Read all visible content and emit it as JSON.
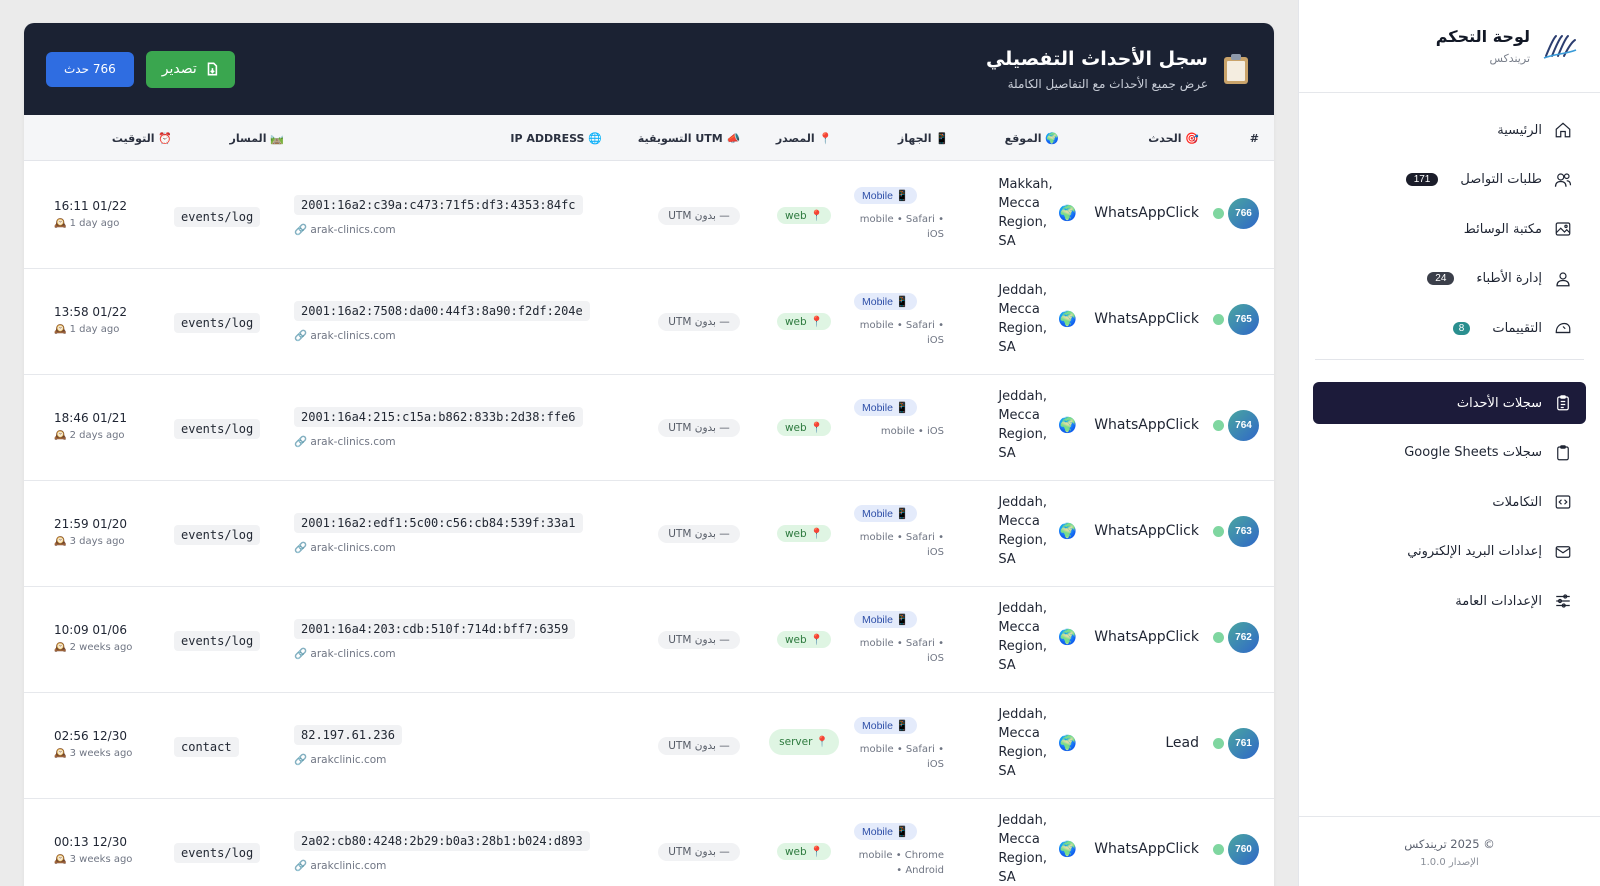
{
  "sidebar": {
    "brand_title": "لوحة التحكم",
    "brand_sub": "تريندكس",
    "items": [
      {
        "label": "الرئيسية",
        "icon": "home-icon",
        "badge": ""
      },
      {
        "label": "طلبات التواصل",
        "icon": "users-icon",
        "badge": "171",
        "badge_color": "#1b1d2a"
      },
      {
        "label": "مكتبة الوسائط",
        "icon": "image-icon",
        "badge": ""
      },
      {
        "label": "إدارة الأطباء",
        "icon": "user-icon",
        "badge": "24",
        "badge_color": "#3b3f4a"
      },
      {
        "label": "التقييمات",
        "icon": "rating-icon",
        "badge": "8",
        "badge_color": "#2a8f8f"
      }
    ],
    "items2": [
      {
        "label": "سجلات الأحداث",
        "icon": "clipboard-icon",
        "active": true
      },
      {
        "label": "سجلات Google Sheets",
        "icon": "sheet-icon"
      },
      {
        "label": "التكاملات",
        "icon": "code-icon"
      },
      {
        "label": "إعدادات البريد الإلكتروني",
        "icon": "mail-icon"
      },
      {
        "label": "الإعدادات العامة",
        "icon": "sliders-icon"
      }
    ],
    "footer": "© 2025 تريندكس",
    "version": "الإصدار 1.0.0"
  },
  "header": {
    "title": "سجل الأحداث التفصيلي",
    "subtitle": "عرض جميع الأحداث مع التفاصيل الكاملة",
    "export_label": "تصدير",
    "count_label": "766 حدث"
  },
  "columns": {
    "num": "#",
    "event": "🎯 الحدث",
    "location": "🌍 الموقع",
    "device": "📱 الجهاز",
    "source": "📍 المصدر",
    "utm": "�However UTM التسويقية",
    "ip": "🌐 IP ADDRESS",
    "path": "🛤️ المسار",
    "time": "⏰ التوقيت"
  },
  "rows": [
    {
      "num": "766",
      "event": "WhatsAppClick",
      "location": "Makkah, Mecca Region, SA",
      "device": "Mobile 📱",
      "device_sub": "mobile • Safari • iOS",
      "source": "📍 web",
      "utm": "— بدون UTM",
      "ip": "2001:16a2:c39a:c473:71f5:df3:4353:84fc",
      "host": "🔗 arak-clinics.com",
      "path": "events/log",
      "time": "16:11 01/22",
      "ago": "🕰️ 1 day ago"
    },
    {
      "num": "765",
      "event": "WhatsAppClick",
      "location": "Jeddah, Mecca Region, SA",
      "device": "Mobile 📱",
      "device_sub": "mobile • Safari • iOS",
      "source": "📍 web",
      "utm": "— بدون UTM",
      "ip": "2001:16a2:7508:da00:44f3:8a90:f2df:204e",
      "host": "🔗 arak-clinics.com",
      "path": "events/log",
      "time": "13:58 01/22",
      "ago": "🕰️ 1 day ago"
    },
    {
      "num": "764",
      "event": "WhatsAppClick",
      "location": "Jeddah, Mecca Region, SA",
      "device": "Mobile 📱",
      "device_sub": "mobile • iOS",
      "source": "📍 web",
      "utm": "— بدون UTM",
      "ip": "2001:16a4:215:c15a:b862:833b:2d38:ffe6",
      "host": "🔗 arak-clinics.com",
      "path": "events/log",
      "time": "18:46 01/21",
      "ago": "🕰️ 2 days ago"
    },
    {
      "num": "763",
      "event": "WhatsAppClick",
      "location": "Jeddah, Mecca Region, SA",
      "device": "Mobile 📱",
      "device_sub": "mobile • Safari • iOS",
      "source": "📍 web",
      "utm": "— بدون UTM",
      "ip": "2001:16a2:edf1:5c00:c56:cb84:539f:33a1",
      "host": "🔗 arak-clinics.com",
      "path": "events/log",
      "time": "21:59 01/20",
      "ago": "🕰️ 3 days ago"
    },
    {
      "num": "762",
      "event": "WhatsAppClick",
      "location": "Jeddah, Mecca Region, SA",
      "device": "Mobile 📱",
      "device_sub": "mobile • Safari • iOS",
      "source": "📍 web",
      "utm": "— بدون UTM",
      "ip": "2001:16a4:203:cdb:510f:714d:bff7:6359",
      "host": "🔗 arak-clinics.com",
      "path": "events/log",
      "time": "10:09 01/06",
      "ago": "🕰️ 2 weeks ago"
    },
    {
      "num": "761",
      "event": "Lead",
      "location": "Jeddah, Mecca Region, SA",
      "device": "Mobile 📱",
      "device_sub": "mobile • Safari • iOS",
      "source": "📍 server",
      "utm": "— بدون UTM",
      "ip": "82.197.61.236",
      "host": "🔗 arakclinic.com",
      "path": "contact",
      "time": "02:56 12/30",
      "ago": "🕰️ 3 weeks ago"
    },
    {
      "num": "760",
      "event": "WhatsAppClick",
      "location": "Jeddah, Mecca Region, SA",
      "device": "Mobile 📱",
      "device_sub": "mobile • Chrome • Android",
      "source": "📍 web",
      "utm": "— بدون UTM",
      "ip": "2a02:cb80:4248:2b29:b0a3:28b1:b024:d893",
      "host": "🔗 arakclinic.com",
      "path": "events/log",
      "time": "00:13 12/30",
      "ago": "🕰️ 3 weeks ago"
    }
  ]
}
